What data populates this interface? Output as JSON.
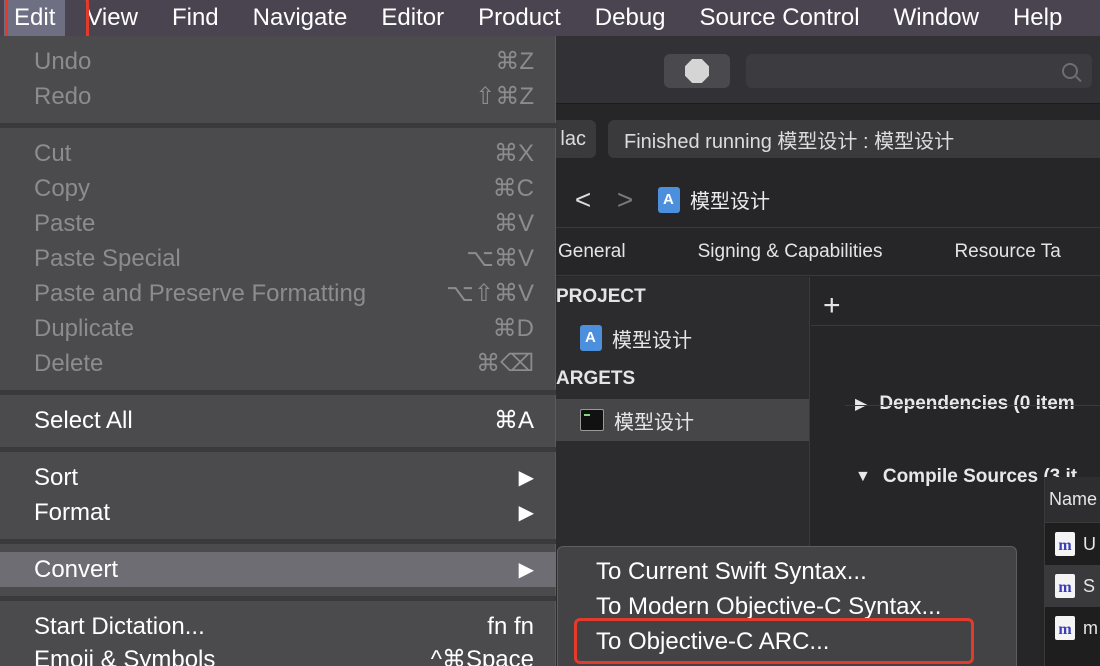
{
  "menubar": {
    "items": [
      "Edit",
      "View",
      "Find",
      "Navigate",
      "Editor",
      "Product",
      "Debug",
      "Source Control",
      "Window",
      "Help"
    ],
    "active": "Edit"
  },
  "edit_menu": {
    "undo": {
      "label": "Undo",
      "shortcut": "⌘Z"
    },
    "redo": {
      "label": "Redo",
      "shortcut": "⇧⌘Z"
    },
    "cut": {
      "label": "Cut",
      "shortcut": "⌘X"
    },
    "copy": {
      "label": "Copy",
      "shortcut": "⌘C"
    },
    "paste": {
      "label": "Paste",
      "shortcut": "⌘V"
    },
    "paste_special": {
      "label": "Paste Special",
      "shortcut": "⌥⌘V"
    },
    "paste_preserve": {
      "label": "Paste and Preserve Formatting",
      "shortcut": "⌥⇧⌘V"
    },
    "duplicate": {
      "label": "Duplicate",
      "shortcut": "⌘D"
    },
    "delete": {
      "label": "Delete",
      "shortcut": "⌘⌫"
    },
    "select_all": {
      "label": "Select All",
      "shortcut": "⌘A"
    },
    "sort": {
      "label": "Sort",
      "arrow": "▶"
    },
    "format": {
      "label": "Format",
      "arrow": "▶"
    },
    "convert": {
      "label": "Convert",
      "arrow": "▶"
    },
    "start_dictation": {
      "label": "Start Dictation...",
      "shortcut": "fn fn"
    },
    "emoji_symbols": {
      "label": "Emoji & Symbols",
      "shortcut": "^⌘Space"
    }
  },
  "convert_submenu": {
    "swift": "To Current Swift Syntax...",
    "modern_objc": "To Modern Objective-C Syntax...",
    "objc_arc": "To Objective-C ARC..."
  },
  "xcode": {
    "scheme_partial": "lac",
    "status": "Finished running 模型设计 : 模型设计",
    "breadcrumb": "模型设计",
    "nav_back": "<",
    "nav_forward": ">",
    "tabs": [
      "General",
      "Signing & Capabilities",
      "Resource Ta"
    ],
    "sidebar": {
      "project_header": "PROJECT",
      "project_item": "模型设计",
      "targets_header": "ARGETS",
      "target_item": "模型设计"
    },
    "add_symbol": "+",
    "phases": {
      "dependencies": "Dependencies (0 item",
      "compile_sources": "Compile Sources (3 it"
    },
    "table": {
      "header": "Name",
      "rows": [
        "U",
        "S",
        "m"
      ],
      "file_icon_letter": "m"
    }
  },
  "colors": {
    "menubar_bg": "#4a4350",
    "menu_bg": "#4b4b4e",
    "menu_highlight": "#6d6d73",
    "annotation_red": "#e23b2c"
  }
}
